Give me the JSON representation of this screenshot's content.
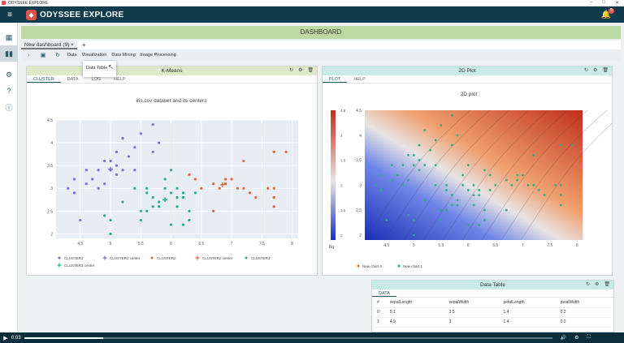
{
  "window": {
    "title": "ODYSSEE EXPLORE"
  },
  "app": {
    "brand": "ODYSSEE EXPLORE",
    "notification_count": "5"
  },
  "icons": {
    "menu": "hamburger-icon",
    "bell": "bell-icon",
    "dashboard": "dashboard-icon",
    "chart": "bar-chart-icon",
    "settings": "gear-icon",
    "help": "question-icon",
    "info": "info-icon"
  },
  "dashboard": {
    "title": "DASHBOARD"
  },
  "tabs": [
    {
      "label": "New dashboard (9)",
      "close": "×"
    }
  ],
  "add_tab": "+",
  "toolbar": {
    "menus": [
      "Data",
      "Visualization",
      "Data Mining",
      "Image Processing"
    ]
  },
  "dropdown": {
    "item": "Data Table"
  },
  "kmeans_panel": {
    "title": "K-Means",
    "tabs": [
      "CLUSTER",
      "DATA",
      "LOG",
      "HELP"
    ]
  },
  "plot2d_panel": {
    "title": "2D Plot",
    "tabs": [
      "PLOT",
      "HELP"
    ]
  },
  "table_panel": {
    "title": "Data Table",
    "tabs": [
      "DATA"
    ],
    "columns": [
      "#",
      "sepalLength",
      "sepalWidth",
      "petalLength",
      "petalWidth"
    ],
    "rows": [
      [
        "0",
        "5.1",
        "3.5",
        "1.4",
        "0.2"
      ],
      [
        "1",
        "4.9",
        "3",
        "1.4",
        "0.2"
      ]
    ]
  },
  "video": {
    "time": "0:03",
    "progress": 0.15
  },
  "chart_data": [
    {
      "type": "scatter",
      "title": "iris.csv dataset and its centers",
      "xlim": [
        4.1,
        8.1
      ],
      "ylim": [
        1.9,
        4.5
      ],
      "xticks": [
        "4.5",
        "5",
        "5.5",
        "6",
        "6.5",
        "7",
        "7.5",
        "8"
      ],
      "yticks": [
        "2",
        "2.5",
        "3",
        "3.5",
        "4",
        "4.5"
      ],
      "legend": [
        "CLUSTER1",
        "CLUSTER1 center",
        "CLUSTER2",
        "CLUSTER2 center",
        "CLUSTER3",
        "CLUSTER3 center"
      ],
      "series": [
        {
          "name": "CLUSTER1",
          "color": "#7b6fd6",
          "points": [
            [
              4.3,
              3.0
            ],
            [
              4.4,
              2.9
            ],
            [
              4.4,
              3.2
            ],
            [
              4.5,
              2.3
            ],
            [
              4.6,
              3.1
            ],
            [
              4.6,
              3.4
            ],
            [
              4.7,
              3.2
            ],
            [
              4.8,
              3.0
            ],
            [
              4.8,
              3.4
            ],
            [
              4.9,
              3.1
            ],
            [
              5.0,
              3.6
            ],
            [
              5.0,
              3.4
            ],
            [
              5.1,
              3.5
            ],
            [
              5.1,
              3.8
            ],
            [
              5.2,
              3.4
            ],
            [
              5.3,
              3.7
            ],
            [
              5.4,
              3.9
            ],
            [
              5.4,
              3.4
            ],
            [
              5.5,
              4.2
            ],
            [
              5.7,
              4.4
            ],
            [
              5.8,
              4.0
            ],
            [
              5.7,
              3.8
            ],
            [
              5.1,
              3.3
            ],
            [
              4.9,
              3.6
            ],
            [
              5.2,
              4.1
            ]
          ]
        },
        {
          "name": "CLUSTER2",
          "color": "#e0673c",
          "points": [
            [
              6.3,
              3.3
            ],
            [
              6.5,
              3.0
            ],
            [
              6.7,
              3.1
            ],
            [
              6.9,
              3.1
            ],
            [
              7.0,
              3.2
            ],
            [
              7.2,
              3.6
            ],
            [
              7.2,
              3.0
            ],
            [
              7.4,
              2.8
            ],
            [
              7.7,
              3.8
            ],
            [
              7.7,
              2.6
            ],
            [
              7.7,
              3.0
            ],
            [
              7.9,
              3.8
            ],
            [
              6.8,
              3.0
            ],
            [
              6.4,
              3.2
            ],
            [
              7.1,
              3.0
            ],
            [
              7.3,
              2.9
            ],
            [
              7.6,
              3.0
            ],
            [
              6.7,
              2.5
            ],
            [
              6.9,
              3.2
            ],
            [
              7.7,
              2.8
            ]
          ]
        },
        {
          "name": "CLUSTER3",
          "color": "#26b07c",
          "points": [
            [
              4.9,
              2.4
            ],
            [
              5.0,
              2.0
            ],
            [
              5.0,
              2.3
            ],
            [
              5.2,
              2.7
            ],
            [
              5.5,
              2.3
            ],
            [
              5.5,
              2.5
            ],
            [
              5.6,
              2.9
            ],
            [
              5.6,
              2.5
            ],
            [
              5.7,
              2.8
            ],
            [
              5.7,
              2.6
            ],
            [
              5.8,
              2.7
            ],
            [
              5.8,
              2.6
            ],
            [
              5.9,
              3.0
            ],
            [
              6.0,
              2.2
            ],
            [
              6.0,
              2.9
            ],
            [
              6.1,
              2.8
            ],
            [
              6.1,
              3.0
            ],
            [
              6.2,
              2.2
            ],
            [
              6.2,
              2.8
            ],
            [
              6.3,
              2.5
            ],
            [
              6.3,
              2.3
            ],
            [
              6.0,
              3.4
            ],
            [
              5.9,
              3.2
            ],
            [
              6.4,
              2.9
            ],
            [
              5.4,
              3.0
            ],
            [
              5.6,
              3.0
            ],
            [
              6.1,
              2.6
            ],
            [
              6.2,
              2.9
            ]
          ]
        }
      ],
      "centers": [
        {
          "name": "CLUSTER1 center",
          "color": "#7b6fd6",
          "x": 5.0,
          "y": 3.42
        },
        {
          "name": "CLUSTER2 center",
          "color": "#e0673c",
          "x": 6.85,
          "y": 3.08
        },
        {
          "name": "CLUSTER3 center",
          "color": "#26b07c",
          "x": 5.9,
          "y": 2.75
        }
      ]
    },
    {
      "type": "heatmap",
      "title": "2D plot",
      "xlim": [
        4.1,
        8.1
      ],
      "ylim": [
        1.9,
        4.5
      ],
      "xticks": [
        "4.5",
        "5",
        "5.5",
        "6",
        "6.5",
        "7",
        "7.5",
        "8"
      ],
      "yticks": [
        "2",
        "2.5",
        "3",
        "3.5",
        "4",
        "4.5"
      ],
      "colorbar_label": "Bg.",
      "legend": [
        "New chart 0",
        "New chart 1"
      ],
      "series": [
        {
          "name": "New chart 0",
          "color": "#e0673c"
        },
        {
          "name": "New chart 1",
          "color": "#26b07c"
        }
      ]
    }
  ]
}
